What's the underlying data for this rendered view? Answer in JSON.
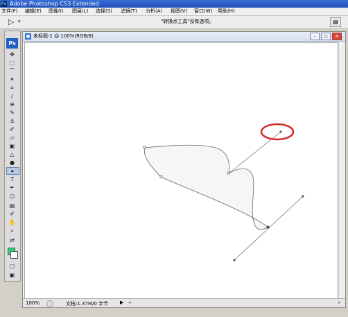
{
  "app": {
    "title": "Adobe Photoshop CS3 Extended",
    "icon_text": "Ps"
  },
  "menu": [
    {
      "label": "文件(F)"
    },
    {
      "label": "编辑(E)"
    },
    {
      "label": "图像(I)"
    },
    {
      "label": "图层(L)"
    },
    {
      "label": "选择(S)"
    },
    {
      "label": "滤镜(T)"
    },
    {
      "label": "分析(A)"
    },
    {
      "label": "视图(V)"
    },
    {
      "label": "窗口(W)"
    },
    {
      "label": "帮助(H)"
    }
  ],
  "options_bar": {
    "tool_icon": "direct-select-arrow-icon",
    "hint": "\"转换点工具\"没有选项。"
  },
  "toolbox": {
    "logo": "Ps",
    "foreground_color": "#29d47a",
    "background_color": "#ffffff"
  },
  "document": {
    "title": "未标题-1 @ 100%(RGB/8)",
    "zoom": "100%",
    "info": "文档:1.37M/0 字节"
  },
  "annotation": {
    "color": "#d62828",
    "shape": "ellipse"
  }
}
